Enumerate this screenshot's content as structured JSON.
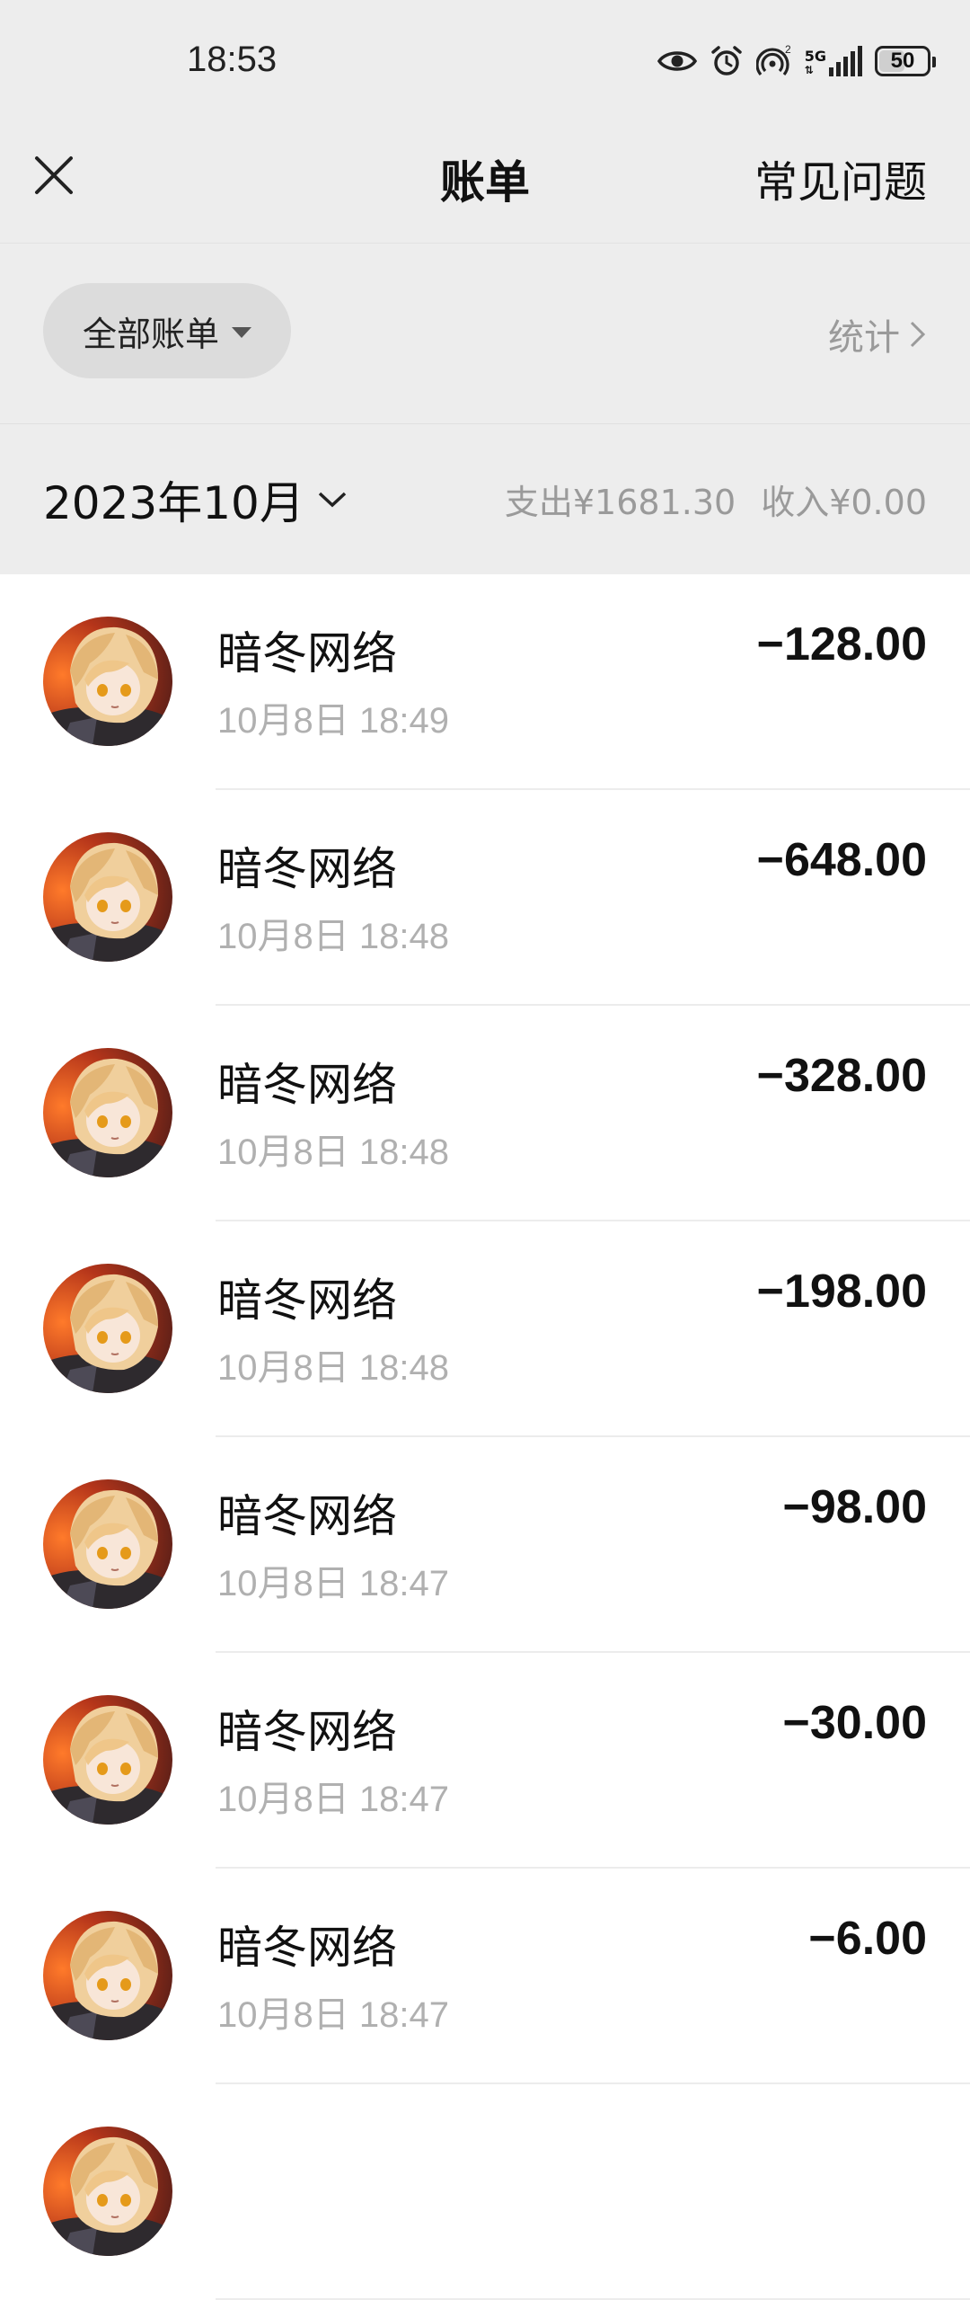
{
  "status_bar": {
    "time": "18:53",
    "battery": "50",
    "network": "5G",
    "sim_index": "2",
    "icons": [
      "eye-icon",
      "alarm-icon",
      "hotspot-icon",
      "signal-icon",
      "battery-icon"
    ]
  },
  "nav": {
    "title": "账单",
    "faq_label": "常见问题",
    "close_icon": "close-icon"
  },
  "filter": {
    "label": "全部账单",
    "stats_label": "统计"
  },
  "month": {
    "label": "2023年10月",
    "expense": "支出¥1681.30",
    "income": "收入¥0.00"
  },
  "transactions": [
    {
      "merchant": "暗冬网络",
      "time": "10月8日 18:49",
      "amount": "−128.00"
    },
    {
      "merchant": "暗冬网络",
      "time": "10月8日 18:48",
      "amount": "−648.00"
    },
    {
      "merchant": "暗冬网络",
      "time": "10月8日 18:48",
      "amount": "−328.00"
    },
    {
      "merchant": "暗冬网络",
      "time": "10月8日 18:48",
      "amount": "−198.00"
    },
    {
      "merchant": "暗冬网络",
      "time": "10月8日 18:47",
      "amount": "−98.00"
    },
    {
      "merchant": "暗冬网络",
      "time": "10月8日 18:47",
      "amount": "−30.00"
    },
    {
      "merchant": "暗冬网络",
      "time": "10月8日 18:47",
      "amount": "−6.00"
    },
    {
      "merchant": "",
      "time": "",
      "amount": ""
    }
  ],
  "colors": {
    "header_bg": "#ededed",
    "pill_bg": "#dcdcdc",
    "secondary_text": "#9a9a9a",
    "time_text": "#b0b0b0"
  }
}
